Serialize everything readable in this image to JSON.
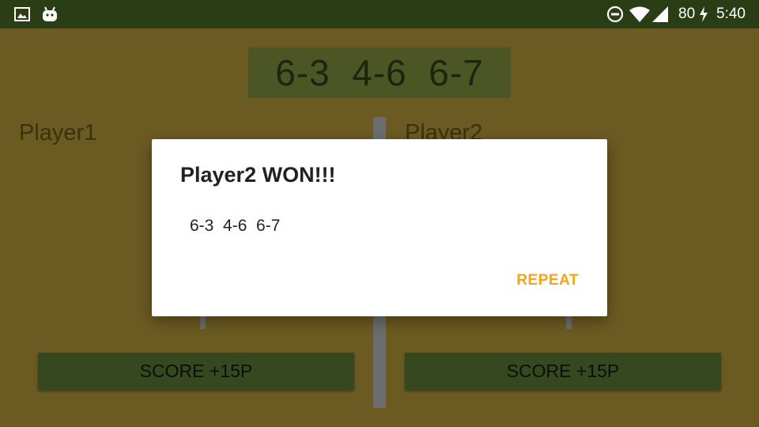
{
  "status_bar": {
    "battery": "80",
    "time": "5:40",
    "icons": [
      "image-icon",
      "android-icon",
      "do-not-disturb-icon",
      "wifi-icon",
      "cell-signal-icon",
      "charging-bolt-icon"
    ]
  },
  "game": {
    "sets_score": "6-3  4-6  6-7",
    "player1": {
      "name": "Player1",
      "score_button": "SCORE +15P"
    },
    "player2": {
      "name": "Player2",
      "score_button": "SCORE +15P"
    }
  },
  "dialog": {
    "title": "Player2 WON!!!",
    "message": "6-3  4-6  6-7",
    "repeat_button": "REPEAT"
  },
  "colors": {
    "status_bar": "#2b3d15",
    "background": "#7a6727",
    "scoreboard": "#566229",
    "score_button": "#3e5224",
    "accent": "#f7a21a"
  }
}
